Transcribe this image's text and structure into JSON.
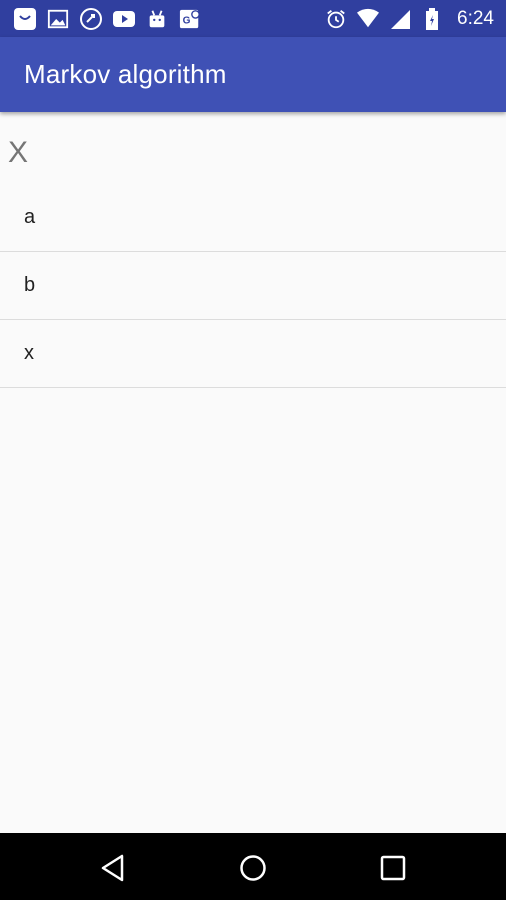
{
  "status_bar": {
    "time": "6:24",
    "notification_icons": [
      "shopping-bag-icon",
      "image-icon",
      "phone-sync-icon",
      "youtube-icon",
      "android-icon",
      "maps-icon"
    ],
    "system_icons": [
      "alarm-icon",
      "wifi-icon",
      "cell-signal-icon",
      "battery-icon"
    ]
  },
  "app_bar": {
    "title": "Markov algorithm"
  },
  "section": {
    "header": "X"
  },
  "list": {
    "items": [
      {
        "label": "a"
      },
      {
        "label": "b"
      },
      {
        "label": "x"
      }
    ]
  },
  "nav_bar": {
    "buttons": [
      "back-icon",
      "home-icon",
      "recents-icon"
    ]
  },
  "colors": {
    "status_bar": "#303f9f",
    "app_bar": "#3f51b5",
    "background": "#fafafa",
    "nav_bar": "#000000"
  }
}
